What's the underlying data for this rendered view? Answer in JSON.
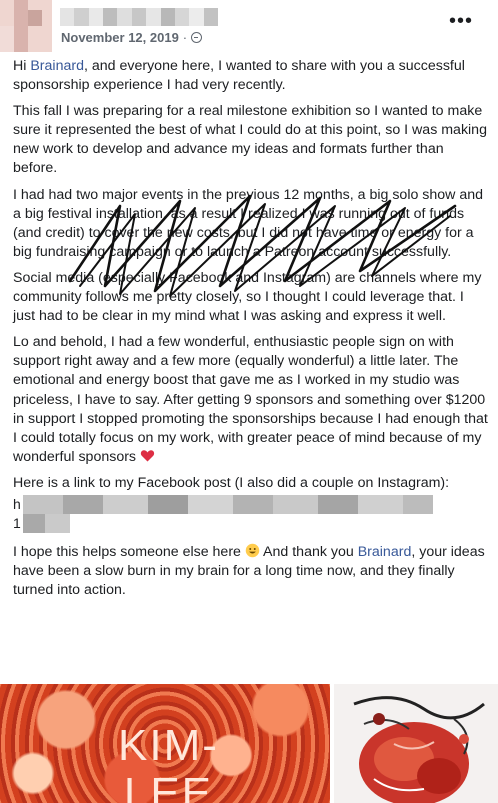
{
  "post": {
    "date": "November 12, 2019",
    "separator": "·",
    "paragraphs": {
      "p1": {
        "a": "Hi ",
        "link": "Brainard",
        "b": ", and everyone here, I wanted to share with you a successful sponsorship experience I had very recently."
      },
      "p2": "This fall I was preparing for a real milestone exhibition so I wanted to make sure it represented the best of what I could do at this point, so I was making new work to develop and advance my ideas and formats further than before.",
      "p3": "I had had two major events in the previous 12 months, a big solo show and a big festival installation, as a result I realized I was running out of funds (and credit) to cover the new costs, but I did not have time or energy for a big fundraising campaign or to launch a Patreon account successfully.",
      "p4": "Social media (especially Facebook and Instagram) are channels where my community follows me pretty closely, so I thought I could leverage that. I just had to be clear in my mind what I was asking and express it well.",
      "p5": "Lo and behold, I had a few wonderful, enthusiastic people sign on with support right away and a few more (equally wonderful) a little later. The emotional and energy boost that gave me as I worked in my studio was priceless, I have to say. After getting 9 sponsors and something over $1200 in support I stopped promoting the sponsorships because I had enough that I could totally focus on my work, with greater peace of mind because of my wonderful sponsors",
      "p6": "Here is a link to my Facebook post (I also did a couple on Instagram):",
      "p6_line1_start": "h",
      "p6_line2_start": "1",
      "p7": {
        "a": "I hope this helps someone else here ",
        "b": " And thank you ",
        "link": "Brainard",
        "c": ", your ideas have been a slow burn in my brain for a long time now, and they finally turned into action."
      }
    }
  },
  "photos": {
    "left_cover_text": "KIM-\nLEE"
  },
  "colors": {
    "link": "#385898",
    "meta": "#606770",
    "text": "#1c1e21"
  },
  "icons": [
    "more-options-icon",
    "globe-icon",
    "red-heart-icon",
    "smiling-face-icon"
  ]
}
